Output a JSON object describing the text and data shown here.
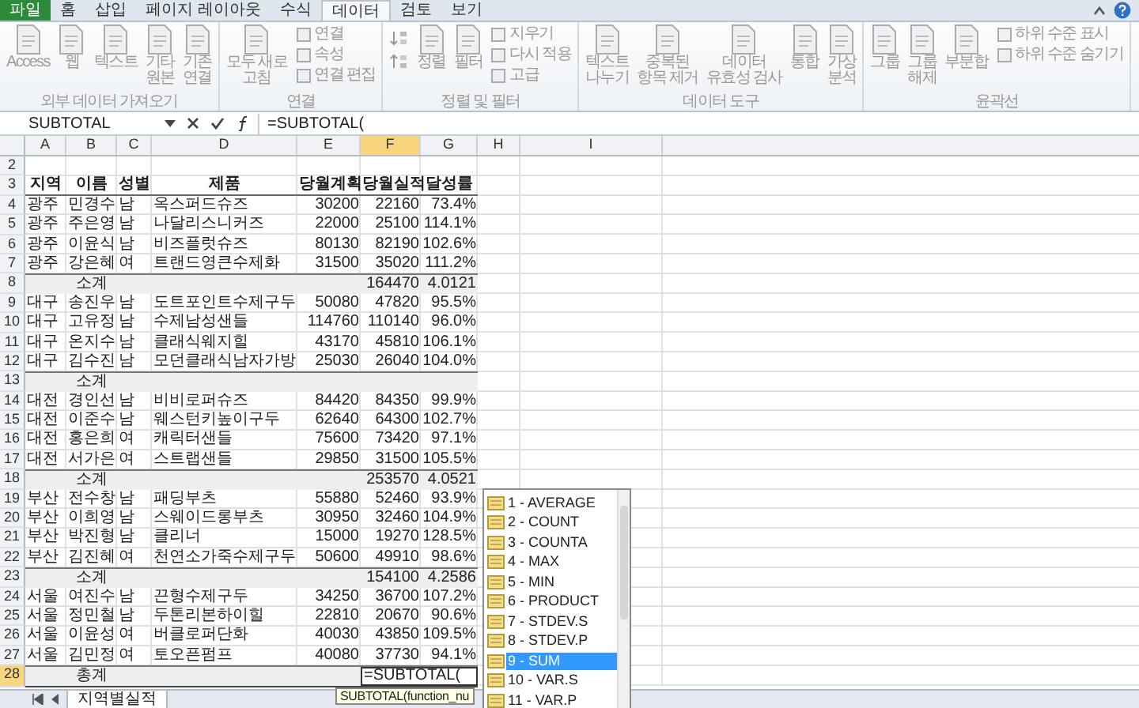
{
  "ribbon_tabs": [
    {
      "label": "파일",
      "kind": "file",
      "selected": false
    },
    {
      "label": "홈",
      "kind": "tab",
      "selected": false
    },
    {
      "label": "삽입",
      "kind": "tab",
      "selected": false
    },
    {
      "label": "페이지 레이아웃",
      "kind": "tab",
      "selected": false
    },
    {
      "label": "수식",
      "kind": "tab",
      "selected": false
    },
    {
      "label": "데이터",
      "kind": "tab",
      "selected": true
    },
    {
      "label": "검토",
      "kind": "tab",
      "selected": false
    },
    {
      "label": "보기",
      "kind": "tab",
      "selected": false
    }
  ],
  "ribbon": {
    "disabled": true,
    "groups": [
      {
        "label": "외부 데이터 가져오기",
        "items": [
          {
            "kind": "large",
            "label": "Access"
          },
          {
            "kind": "large",
            "label": "웹"
          },
          {
            "kind": "large",
            "label": "텍스트"
          },
          {
            "kind": "large",
            "label": "기타\n원본"
          },
          {
            "kind": "large",
            "label": "기존\n연결"
          }
        ]
      },
      {
        "label": "연결",
        "items": [
          {
            "kind": "large",
            "label": "모두 새로\n고침"
          },
          {
            "kind": "stack",
            "buttons": [
              "연결",
              "속성",
              "연결 편집"
            ]
          }
        ]
      },
      {
        "label": "정렬 및 필터",
        "items": [
          {
            "kind": "sort"
          },
          {
            "kind": "large",
            "label": "정렬"
          },
          {
            "kind": "large",
            "label": "필터"
          },
          {
            "kind": "stack",
            "buttons": [
              "지우기",
              "다시 적용",
              "고급"
            ]
          }
        ]
      },
      {
        "label": "데이터 도구",
        "items": [
          {
            "kind": "large",
            "label": "텍스트\n나누기"
          },
          {
            "kind": "large",
            "label": "중복된\n항목 제거"
          },
          {
            "kind": "large",
            "label": "데이터\n유효성 검사"
          },
          {
            "kind": "large",
            "label": "통합"
          },
          {
            "kind": "large",
            "label": "가상\n분석"
          }
        ]
      },
      {
        "label": "윤곽선",
        "items": [
          {
            "kind": "large",
            "label": "그룹"
          },
          {
            "kind": "large",
            "label": "그룹\n해제"
          },
          {
            "kind": "large",
            "label": "부분합"
          },
          {
            "kind": "stack",
            "buttons": [
              "하위 수준 표시",
              "하위 수준 숨기기"
            ]
          }
        ]
      }
    ]
  },
  "formula_bar": {
    "name_box": "SUBTOTAL",
    "formula": "=SUBTOTAL("
  },
  "columns": [
    {
      "label": "A",
      "selected": false
    },
    {
      "label": "B",
      "selected": false
    },
    {
      "label": "C",
      "selected": false
    },
    {
      "label": "D",
      "selected": false
    },
    {
      "label": "E",
      "selected": false
    },
    {
      "label": "F",
      "selected": true
    },
    {
      "label": "G",
      "selected": false
    },
    {
      "label": "H",
      "selected": false
    },
    {
      "label": "I",
      "selected": false
    }
  ],
  "rows": [
    {
      "num": "2",
      "kind": "blank",
      "selected": false
    },
    {
      "num": "3",
      "kind": "header",
      "selected": false,
      "cells": [
        "지역",
        "이름",
        "성별",
        "제품",
        "당월계획",
        "당월실적",
        "달성률"
      ]
    },
    {
      "num": "4",
      "kind": "data",
      "selected": false,
      "cells": [
        "광주",
        "민경수",
        "남",
        "옥스퍼드슈즈",
        "30200",
        "22160",
        "73.4%"
      ]
    },
    {
      "num": "5",
      "kind": "data",
      "selected": false,
      "cells": [
        "광주",
        "주은영",
        "남",
        "나달리스니커즈",
        "22000",
        "25100",
        "114.1%"
      ]
    },
    {
      "num": "6",
      "kind": "data",
      "selected": false,
      "cells": [
        "광주",
        "이윤식",
        "남",
        "비즈플럿슈즈",
        "80130",
        "82190",
        "102.6%"
      ]
    },
    {
      "num": "7",
      "kind": "data",
      "selected": false,
      "cells": [
        "광주",
        "강은혜",
        "여",
        "트랜드영큰수제화",
        "31500",
        "35020",
        "111.2%"
      ]
    },
    {
      "num": "8",
      "kind": "subtotal",
      "selected": false,
      "label": "소계",
      "actual": "164470",
      "rate": "4.0121"
    },
    {
      "num": "9",
      "kind": "data",
      "selected": false,
      "cells": [
        "대구",
        "송진우",
        "남",
        "도트포인트수제구두",
        "50080",
        "47820",
        "95.5%"
      ]
    },
    {
      "num": "10",
      "kind": "data",
      "selected": false,
      "cells": [
        "대구",
        "고유정",
        "남",
        "수제남성샌들",
        "114760",
        "110140",
        "96.0%"
      ]
    },
    {
      "num": "11",
      "kind": "data",
      "selected": false,
      "cells": [
        "대구",
        "온지수",
        "남",
        "클래식웨지힐",
        "43170",
        "45810",
        "106.1%"
      ]
    },
    {
      "num": "12",
      "kind": "data",
      "selected": false,
      "cells": [
        "대구",
        "김수진",
        "남",
        "모던클래식남자가방",
        "25030",
        "26040",
        "104.0%"
      ]
    },
    {
      "num": "13",
      "kind": "subtotal",
      "selected": false,
      "label": "소계"
    },
    {
      "num": "14",
      "kind": "data",
      "selected": false,
      "cells": [
        "대전",
        "경인선",
        "남",
        "비비로퍼슈즈",
        "84420",
        "84350",
        "99.9%"
      ]
    },
    {
      "num": "15",
      "kind": "data",
      "selected": false,
      "cells": [
        "대전",
        "이준수",
        "남",
        "웨스턴키높이구두",
        "62640",
        "64300",
        "102.7%"
      ]
    },
    {
      "num": "16",
      "kind": "data",
      "selected": false,
      "cells": [
        "대전",
        "홍은희",
        "여",
        "캐릭터샌들",
        "75600",
        "73420",
        "97.1%"
      ]
    },
    {
      "num": "17",
      "kind": "data",
      "selected": false,
      "cells": [
        "대전",
        "서가은",
        "여",
        "스트랩샌들",
        "29850",
        "31500",
        "105.5%"
      ]
    },
    {
      "num": "18",
      "kind": "subtotal",
      "selected": false,
      "label": "소계",
      "actual": "253570",
      "rate": "4.0521"
    },
    {
      "num": "19",
      "kind": "data",
      "selected": false,
      "cells": [
        "부산",
        "전수창",
        "남",
        "패딩부츠",
        "55880",
        "52460",
        "93.9%"
      ]
    },
    {
      "num": "20",
      "kind": "data",
      "selected": false,
      "cells": [
        "부산",
        "이희영",
        "남",
        "스웨이드롱부츠",
        "30950",
        "32460",
        "104.9%"
      ]
    },
    {
      "num": "21",
      "kind": "data",
      "selected": false,
      "cells": [
        "부산",
        "박진형",
        "남",
        "클리너",
        "15000",
        "19270",
        "128.5%"
      ]
    },
    {
      "num": "22",
      "kind": "data",
      "selected": false,
      "cells": [
        "부산",
        "김진혜",
        "여",
        "천연소가죽수제구두",
        "50600",
        "49910",
        "98.6%"
      ]
    },
    {
      "num": "23",
      "kind": "subtotal",
      "selected": false,
      "label": "소계",
      "actual": "154100",
      "rate": "4.2586"
    },
    {
      "num": "24",
      "kind": "data",
      "selected": false,
      "cells": [
        "서울",
        "여진수",
        "남",
        "끈형수제구두",
        "34250",
        "36700",
        "107.2%"
      ]
    },
    {
      "num": "25",
      "kind": "data",
      "selected": false,
      "cells": [
        "서울",
        "정민철",
        "남",
        "두톤리본하이힐",
        "22810",
        "20670",
        "90.6%"
      ]
    },
    {
      "num": "26",
      "kind": "data",
      "selected": false,
      "cells": [
        "서울",
        "이윤성",
        "여",
        "버클로퍼단화",
        "40030",
        "43850",
        "109.5%"
      ]
    },
    {
      "num": "27",
      "kind": "data",
      "selected": false,
      "cells": [
        "서울",
        "김민정",
        "여",
        "토오픈펌프",
        "40080",
        "37730",
        "94.1%"
      ]
    },
    {
      "num": "28",
      "kind": "total",
      "selected": true,
      "label": "총계",
      "editing": "=SUBTOTAL("
    }
  ],
  "tooltip": "SUBTOTAL(function_nu",
  "autocomplete": [
    {
      "label": "1 - AVERAGE",
      "selected": false
    },
    {
      "label": "2 - COUNT",
      "selected": false
    },
    {
      "label": "3 - COUNTA",
      "selected": false
    },
    {
      "label": "4 - MAX",
      "selected": false
    },
    {
      "label": "5 - MIN",
      "selected": false
    },
    {
      "label": "6 - PRODUCT",
      "selected": false
    },
    {
      "label": "7 - STDEV.S",
      "selected": false
    },
    {
      "label": "8 - STDEV.P",
      "selected": false
    },
    {
      "label": "9 - SUM",
      "selected": true
    },
    {
      "label": "10 - VAR.S",
      "selected": false
    },
    {
      "label": "11 - VAR.P",
      "selected": false
    }
  ],
  "sheet_tabs": [
    {
      "label": "지역별실적",
      "selected": true
    }
  ]
}
